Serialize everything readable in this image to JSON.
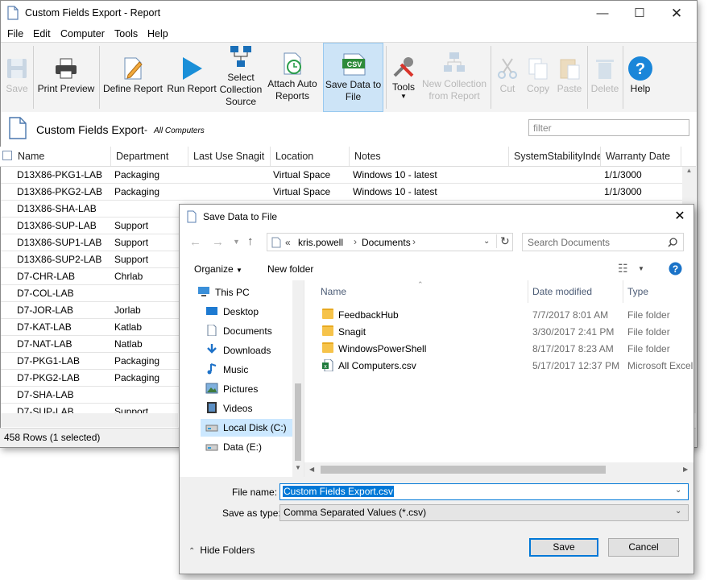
{
  "main": {
    "title": "Custom Fields Export - Report",
    "menu": [
      "File",
      "Edit",
      "Computer",
      "Tools",
      "Help"
    ],
    "toolbar": [
      {
        "name": "save",
        "label": "Save",
        "disabled": true
      },
      {
        "name": "print-preview",
        "label": "Print Preview",
        "disabled": false
      },
      {
        "name": "define-report",
        "label": "Define Report",
        "disabled": false
      },
      {
        "name": "run-report",
        "label": "Run Report",
        "disabled": false
      },
      {
        "name": "select-collection-source",
        "label": "Select Collection Source",
        "disabled": false
      },
      {
        "name": "attach-auto-reports",
        "label": "Attach Auto Reports",
        "disabled": false
      },
      {
        "name": "save-data-to-file",
        "label": "Save Data to File",
        "disabled": false,
        "selected": true
      },
      {
        "name": "tools",
        "label": "Tools",
        "disabled": false
      },
      {
        "name": "new-collection-from-report",
        "label": "New Collection from Report",
        "disabled": true
      },
      {
        "name": "cut",
        "label": "Cut",
        "disabled": true
      },
      {
        "name": "copy",
        "label": "Copy",
        "disabled": true
      },
      {
        "name": "paste",
        "label": "Paste",
        "disabled": true
      },
      {
        "name": "delete",
        "label": "Delete",
        "disabled": true
      },
      {
        "name": "help",
        "label": "Help",
        "disabled": false
      }
    ],
    "csv_badge": "CSV",
    "report_title": "Custom Fields Export",
    "report_subtitle": "All Computers",
    "filter_placeholder": "filter",
    "columns": [
      "Name",
      "Department",
      "Last Use Snagit",
      "Location",
      "Notes",
      "SystemStabilityInde:",
      "Warranty Date"
    ],
    "rows": [
      [
        "D13X86-PKG1-LAB",
        "Packaging",
        "",
        "Virtual Space",
        "Windows 10 - latest",
        "",
        "1/1/3000"
      ],
      [
        "D13X86-PKG2-LAB",
        "Packaging",
        "",
        "Virtual Space",
        "Windows 10 - latest",
        "",
        "1/1/3000"
      ],
      [
        "D13X86-SHA-LAB",
        "",
        "",
        "",
        "",
        "",
        ""
      ],
      [
        "D13X86-SUP-LAB",
        "Support",
        "",
        "",
        "",
        "",
        ""
      ],
      [
        "D13X86-SUP1-LAB",
        "Support",
        "",
        "",
        "",
        "",
        ""
      ],
      [
        "D13X86-SUP2-LAB",
        "Support",
        "",
        "",
        "",
        "",
        ""
      ],
      [
        "D7-CHR-LAB",
        "Chrlab",
        "",
        "",
        "",
        "",
        ""
      ],
      [
        "D7-COL-LAB",
        "",
        "",
        "",
        "",
        "",
        ""
      ],
      [
        "D7-JOR-LAB",
        "Jorlab",
        "",
        "",
        "",
        "",
        ""
      ],
      [
        "D7-KAT-LAB",
        "Katlab",
        "",
        "",
        "",
        "",
        ""
      ],
      [
        "D7-NAT-LAB",
        "Natlab",
        "",
        "",
        "",
        "",
        ""
      ],
      [
        "D7-PKG1-LAB",
        "Packaging",
        "",
        "",
        "",
        "",
        ""
      ],
      [
        "D7-PKG2-LAB",
        "Packaging",
        "",
        "",
        "",
        "",
        ""
      ],
      [
        "D7-SHA-LAB",
        "",
        "",
        "",
        "",
        "",
        ""
      ],
      [
        "D7-SUP-LAB",
        "Support",
        "",
        "",
        "",
        "",
        ""
      ]
    ],
    "status": "458 Rows (1 selected)"
  },
  "dialog": {
    "title": "Save Data to File",
    "breadcrumb_prefix": "«",
    "breadcrumb": [
      "kris.powell",
      "Documents"
    ],
    "search_placeholder": "Search Documents",
    "organize_label": "Organize",
    "new_folder_label": "New folder",
    "tree": [
      {
        "label": "This PC",
        "icon": "pc-icon",
        "level": 0
      },
      {
        "label": "Desktop",
        "icon": "desktop-icon",
        "level": 1
      },
      {
        "label": "Documents",
        "icon": "documents-icon",
        "level": 1
      },
      {
        "label": "Downloads",
        "icon": "downloads-icon",
        "level": 1
      },
      {
        "label": "Music",
        "icon": "music-icon",
        "level": 1
      },
      {
        "label": "Pictures",
        "icon": "pictures-icon",
        "level": 1
      },
      {
        "label": "Videos",
        "icon": "videos-icon",
        "level": 1
      },
      {
        "label": "Local Disk (C:)",
        "icon": "drive-icon",
        "level": 1,
        "selected": true
      },
      {
        "label": "Data (E:)",
        "icon": "drive-icon",
        "level": 1
      }
    ],
    "file_columns": [
      "Name",
      "Date modified",
      "Type"
    ],
    "files": [
      {
        "name": "FeedbackHub",
        "date": "7/7/2017 8:01 AM",
        "type": "File folder",
        "icon": "folder-icon"
      },
      {
        "name": "Snagit",
        "date": "3/30/2017 2:41 PM",
        "type": "File folder",
        "icon": "folder-icon"
      },
      {
        "name": "WindowsPowerShell",
        "date": "8/17/2017 8:23 AM",
        "type": "File folder",
        "icon": "folder-icon"
      },
      {
        "name": "All Computers.csv",
        "date": "5/17/2017 12:37 PM",
        "type": "Microsoft Excel",
        "icon": "excel-file-icon"
      }
    ],
    "file_name_label": "File name:",
    "file_name_value": "Custom Fields Export.csv",
    "save_as_type_label": "Save as type:",
    "save_as_type_value": "Comma Separated Values (*.csv)",
    "hide_folders_label": "Hide Folders",
    "save_label": "Save",
    "cancel_label": "Cancel"
  },
  "colors": {
    "accent": "#0078d7",
    "selection": "#cce8ff",
    "toolbar_selected": "#cde4f7"
  }
}
